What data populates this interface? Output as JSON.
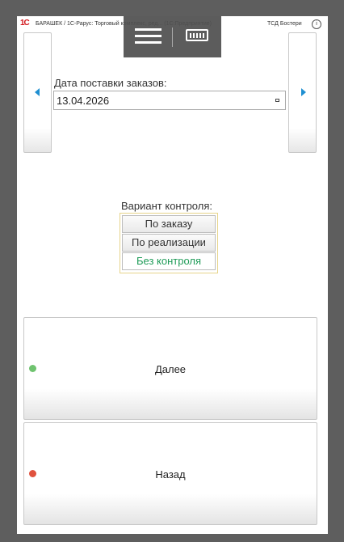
{
  "titlebar": {
    "logo": "1С",
    "title": "БАРАШЕК / 1С-Рарус: Торговый комплекс, ред... (1С:Предприятие)",
    "tsd": "ТСД Бостери",
    "info": "i"
  },
  "date_section": {
    "label": "Дата поставки заказов:",
    "value": "13.04.2026"
  },
  "control": {
    "label": "Вариант контроля:",
    "options": [
      "По заказу",
      "По реализации",
      "Без контроля"
    ],
    "selected": "Без контроля"
  },
  "buttons": {
    "next": "Далее",
    "back": "Назад"
  },
  "colors": {
    "accent_green": "#1e9b57",
    "arrow_blue": "#1f8fd1",
    "next_dot": "#6fc36f",
    "back_dot": "#e0523e"
  },
  "icons": {
    "menu": "hamburger-icon",
    "keyboard": "keyboard-icon",
    "prev": "arrow-left-icon",
    "next": "arrow-right-icon"
  }
}
